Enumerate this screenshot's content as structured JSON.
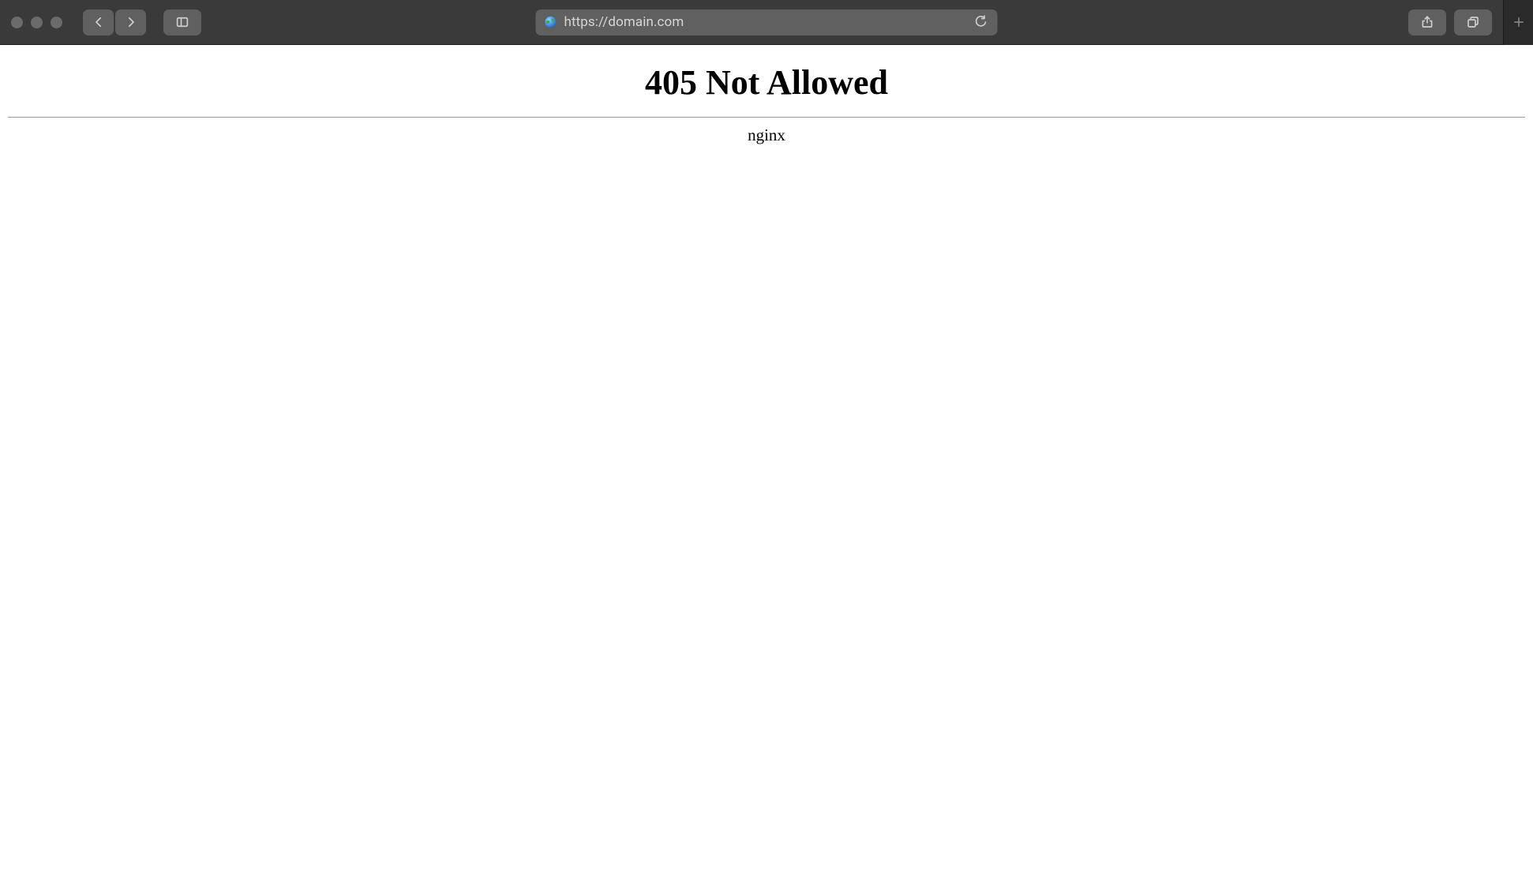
{
  "browser": {
    "url": "https://domain.com",
    "site_icon": "globe-icon"
  },
  "page": {
    "error_title": "405 Not Allowed",
    "server_name": "nginx"
  }
}
